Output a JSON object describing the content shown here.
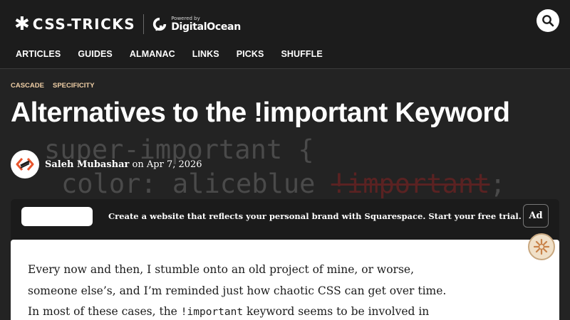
{
  "header": {
    "logo_text": "CSS-TRICKS",
    "sponsor_powered": "Powered by",
    "sponsor_name": "DigitalOcean",
    "nav": [
      "ARTICLES",
      "GUIDES",
      "ALMANAC",
      "LINKS",
      "PICKS",
      "SHUFFLE"
    ]
  },
  "hero": {
    "tags": [
      "CASCADE",
      "SPECIFICITY"
    ],
    "title": "Alternatives to the !important Keyword",
    "code_line1": "super-important {",
    "code_line2_prop": "color: aliceblue ",
    "code_line2_strike": "!important",
    "code_line2_end": ";"
  },
  "byline": {
    "author": "Saleh Mubashar",
    "date_prefix": "on",
    "date": "Apr 7, 2026"
  },
  "ad": {
    "text": "Create a website that reflects your personal brand with Squarespace. Start your free trial.",
    "badge": "Ad"
  },
  "article": {
    "line1": "Every now and then, I stumble onto an old project of mine, or worse,",
    "line2": "someone else’s, and I’m reminded just how chaotic CSS can get over time.",
    "line3_pre": "In most of these cases, the ",
    "line3_code": "!important",
    "line3_post": " keyword seems to be involved in"
  },
  "colors": {
    "tag": "#f0cfa6",
    "background": "#1f1f1f",
    "card": "#ffffff"
  }
}
